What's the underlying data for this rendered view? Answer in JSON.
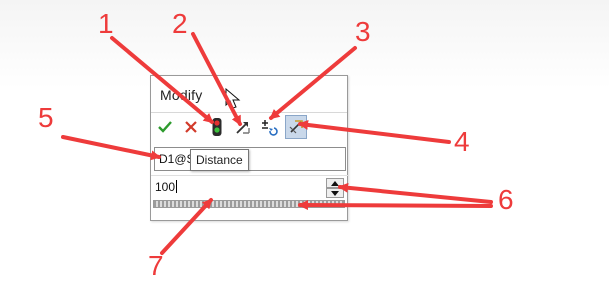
{
  "dialog": {
    "title": "Modify",
    "name_value": "D1@S",
    "tooltip": "Distance",
    "value": "100"
  },
  "toolbar": {
    "ok_icon": "checkmark-icon",
    "cancel_icon": "x-icon",
    "rebuild_icon": "traffic-light-icon",
    "reverse_icon": "reverse-direction-icon",
    "reset_icon": "reset-spin-increment-icon",
    "mark_icon": "mark-dimension-icon"
  },
  "callouts": {
    "n1": "1",
    "n2": "2",
    "n3": "3",
    "n4": "4",
    "n5": "5",
    "n6": "6",
    "n7": "7"
  },
  "colors": {
    "callout": "#ee3b3b",
    "ok": "#2e9b2e",
    "cancel": "#d23a2a"
  }
}
